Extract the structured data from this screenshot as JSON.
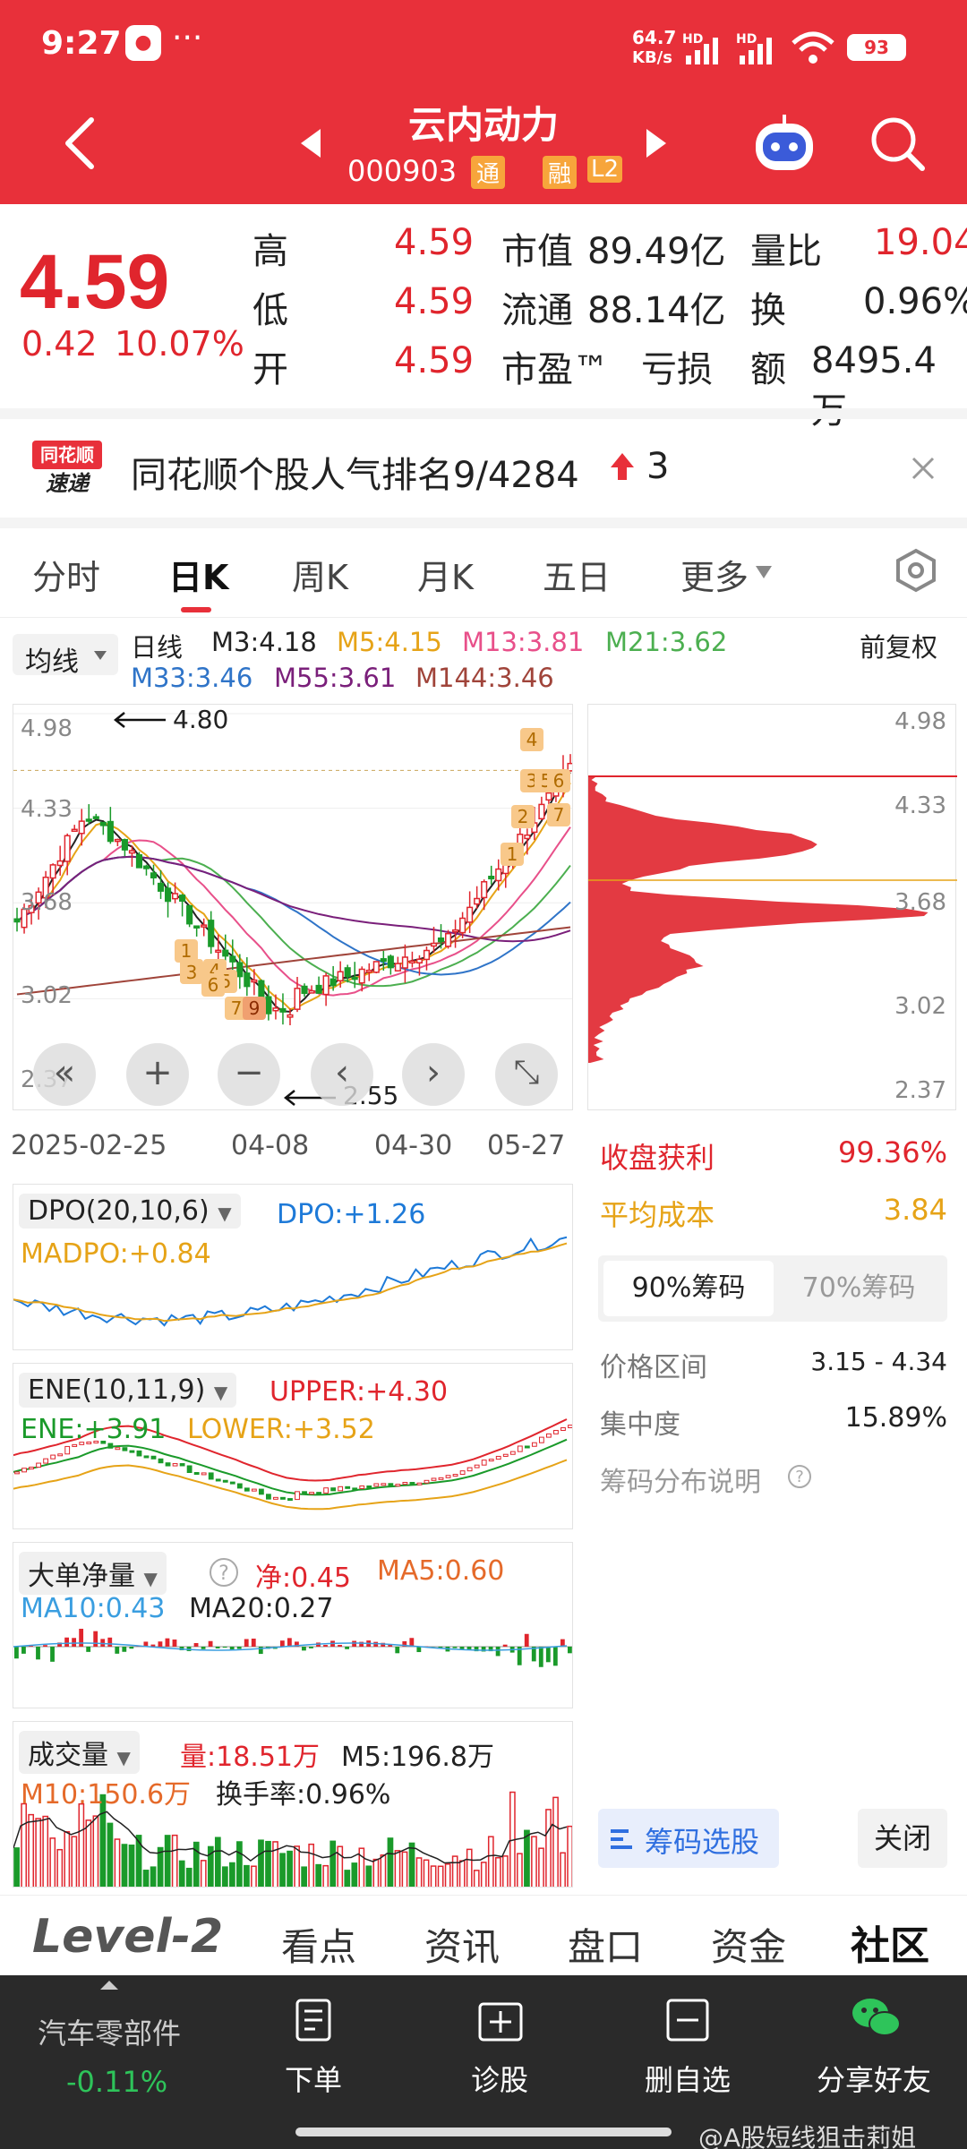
{
  "status_bar": {
    "time": "9:27",
    "app_badge": "●",
    "dots": "···",
    "speed": "64.7",
    "speed_unit": "KB/s",
    "hd1": "HD",
    "hd2": "HD",
    "battery": "93"
  },
  "header": {
    "title": "云内动力",
    "code": "000903",
    "tag_1": "通",
    "tag_2": "融",
    "tag_3": "L2"
  },
  "quote": {
    "price": "4.59",
    "change": "0.42",
    "change_pct": "10.07%",
    "rows": [
      {
        "k1": "高",
        "v1": "4.59",
        "k2": "市值",
        "v2": "89.49亿",
        "k3": "量比",
        "v3": "19.04"
      },
      {
        "k1": "低",
        "v1": "4.59",
        "k2": "流通",
        "v2": "88.14亿",
        "k3": "换",
        "v3": "0.96%"
      },
      {
        "k1": "开",
        "v1": "4.59",
        "k2": "市盈™",
        "v2": "亏损",
        "k3": "额",
        "v3": "8495.4万"
      }
    ]
  },
  "ranking": {
    "logo_top": "同花顺",
    "logo_bottom": "速递",
    "text": "同花顺个股人气排名9/4284",
    "rise": "3"
  },
  "tabs": [
    "分时",
    "日K",
    "周K",
    "月K",
    "五日",
    "更多"
  ],
  "ma_bar": {
    "selector": "均线",
    "period": "日线",
    "fq": "前复权",
    "items": [
      {
        "text": "M3:4.18",
        "color": "#222222"
      },
      {
        "text": "M5:4.15",
        "color": "#e6a317"
      },
      {
        "text": "M13:3.81",
        "color": "#e8508a"
      },
      {
        "text": "M21:3.62",
        "color": "#4caf50"
      },
      {
        "text": "M33:3.46",
        "color": "#2f74c8"
      },
      {
        "text": "M55:3.61",
        "color": "#7a1f7a"
      },
      {
        "text": "M144:3.46",
        "color": "#a0443a"
      }
    ]
  },
  "kline": {
    "y_ticks": [
      "4.98",
      "4.33",
      "3.68",
      "3.02",
      "2.37"
    ],
    "high_mark": "4.80",
    "low_mark": "2.55",
    "x_dates": [
      "2025-02-25",
      "04-08",
      "04-30",
      "05-27"
    ],
    "event_markers": [
      "1",
      "2",
      "3",
      "4",
      "5",
      "6",
      "7",
      "1",
      "2",
      "3",
      "4",
      "5",
      "6",
      "7",
      "9"
    ],
    "controls": [
      "«",
      "+",
      "−",
      "‹",
      "›",
      "⤡"
    ]
  },
  "chips": {
    "y_ticks": [
      "4.98",
      "4.33",
      "3.68",
      "3.02",
      "2.37"
    ],
    "profit_label": "收盘获利",
    "profit_value": "99.36%",
    "cost_label": "平均成本",
    "cost_value": "3.84",
    "tab_90": "90%筹码",
    "tab_70": "70%筹码",
    "range_label": "价格区间",
    "range_value": "3.15 - 4.34",
    "conc_label": "集中度",
    "conc_value": "15.89%",
    "explain": "筹码分布说明",
    "select_button": "筹码选股",
    "close_button": "关闭"
  },
  "dpo": {
    "name": "DPO(20,10,6)",
    "dpo": "DPO:+1.26",
    "madpo": "MADPO:+0.84"
  },
  "ene": {
    "name": "ENE(10,11,9)",
    "upper": "UPPER:+4.30",
    "ene": "ENE:+3.91",
    "lower": "LOWER:+3.52"
  },
  "ddx": {
    "name": "大单净量",
    "net": "净:0.45",
    "ma5": "MA5:0.60",
    "ma10": "MA10:0.43",
    "ma20": "MA20:0.27"
  },
  "volume": {
    "name": "成交量",
    "vol": "量:18.51万",
    "m5": "M5:196.8万",
    "m10": "M10:150.6万",
    "turnover": "换手率:0.96%"
  },
  "bottom_tabs": [
    "Level-2",
    "看点",
    "资讯",
    "盘口",
    "资金",
    "社区"
  ],
  "bottom_bar": {
    "sector": "汽车零部件",
    "sector_change": "-0.11%",
    "buttons": [
      "下单",
      "诊股",
      "删自选",
      "分享好友"
    ]
  },
  "watermark": "@A股短线狙击莉姐"
}
